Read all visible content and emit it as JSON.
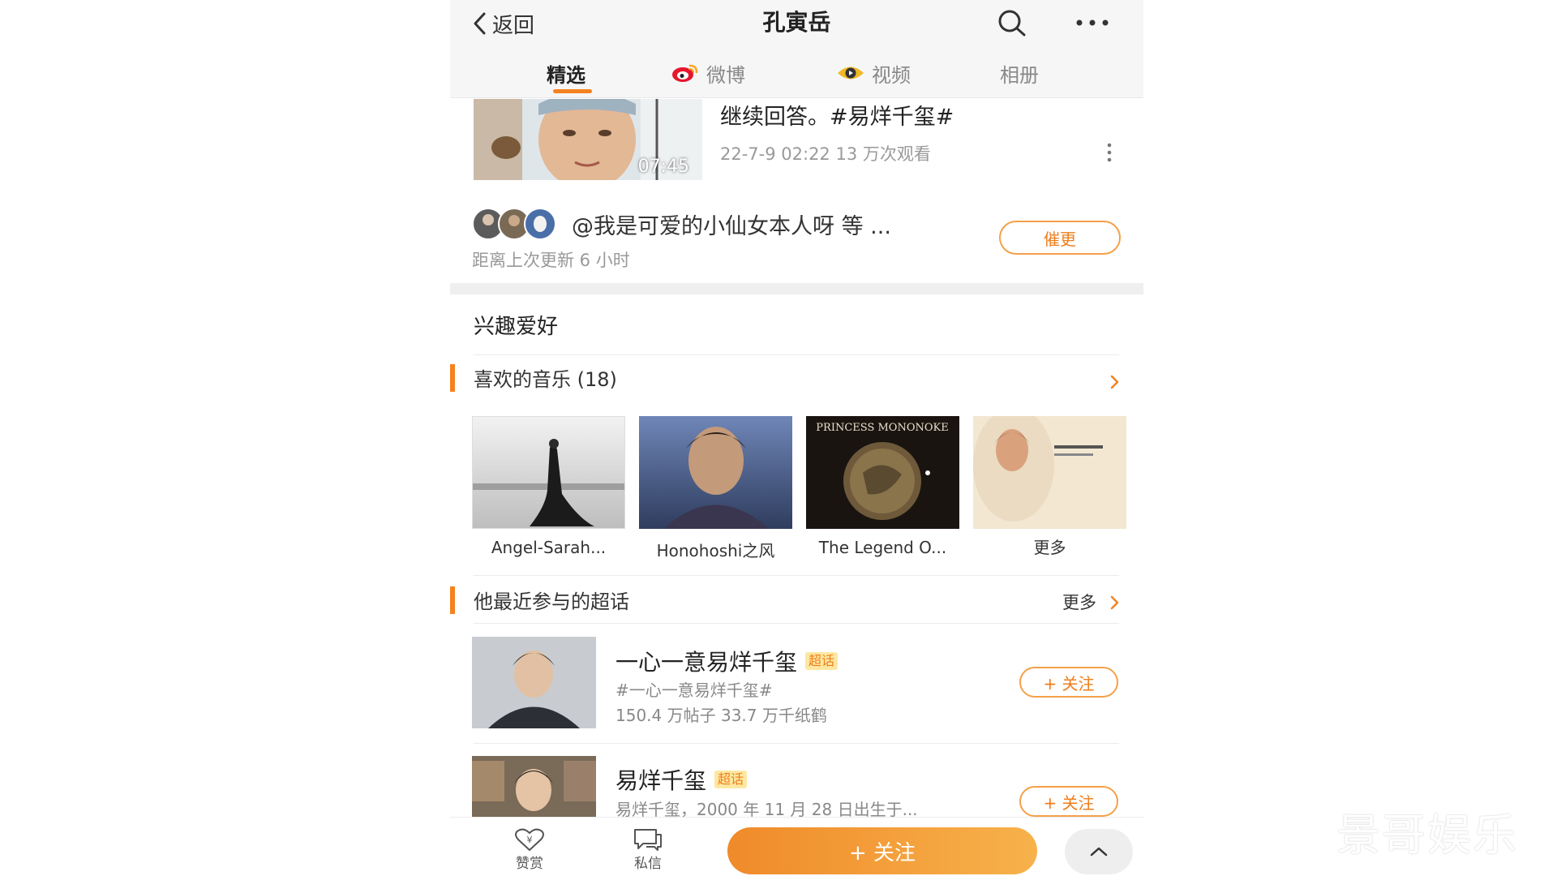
{
  "nav": {
    "back_label": "返回",
    "title": "孔寅岳",
    "search_icon": "search-icon",
    "more_icon": "more-horizontal-icon"
  },
  "tabs": [
    {
      "label": "精选",
      "icon": "",
      "active": true
    },
    {
      "label": "微博",
      "icon": "weibo-logo-icon",
      "active": false
    },
    {
      "label": "视频",
      "icon": "video-eye-icon",
      "active": false
    },
    {
      "label": "相册",
      "icon": "",
      "active": false
    }
  ],
  "video": {
    "duration": "07:45",
    "title": "继续回答。#易烊千玺#",
    "meta": "22-7-9 02:22 13 万次观看"
  },
  "update": {
    "followers_text": "@我是可爱的小仙女本人呀 等 ...",
    "last_update": "距离上次更新 6 小时",
    "urge_label": "催更"
  },
  "hobbies": {
    "section_title": "兴趣爱好",
    "music_header": "喜欢的音乐 (18)",
    "albums": [
      {
        "label": "Angel-Sarah..."
      },
      {
        "label": "Honohoshi之风"
      },
      {
        "label": "The Legend O..."
      },
      {
        "label": "更多"
      }
    ]
  },
  "topics": {
    "header": "他最近参与的超话",
    "more_label": "更多",
    "items": [
      {
        "name": "一心一意易烊千玺",
        "badge": "超话",
        "tag": "#一心一意易烊千玺#",
        "stats": "150.4 万帖子 33.7 万千纸鹤",
        "follow_label": "+ 关注"
      },
      {
        "name": "易烊千玺",
        "badge": "超话",
        "tag": "易烊千玺，2000 年 11 月 28 日出生于...",
        "follow_label": "+ 关注"
      }
    ]
  },
  "bottom": {
    "reward_label": "赞赏",
    "message_label": "私信",
    "follow_label": "+ 关注"
  },
  "watermark": "景哥娱乐",
  "colors": {
    "accent": "#f58220",
    "follow_gradient_start": "#f08a2a",
    "follow_gradient_end": "#f7b24b",
    "badge_bg": "#fde8a2"
  }
}
